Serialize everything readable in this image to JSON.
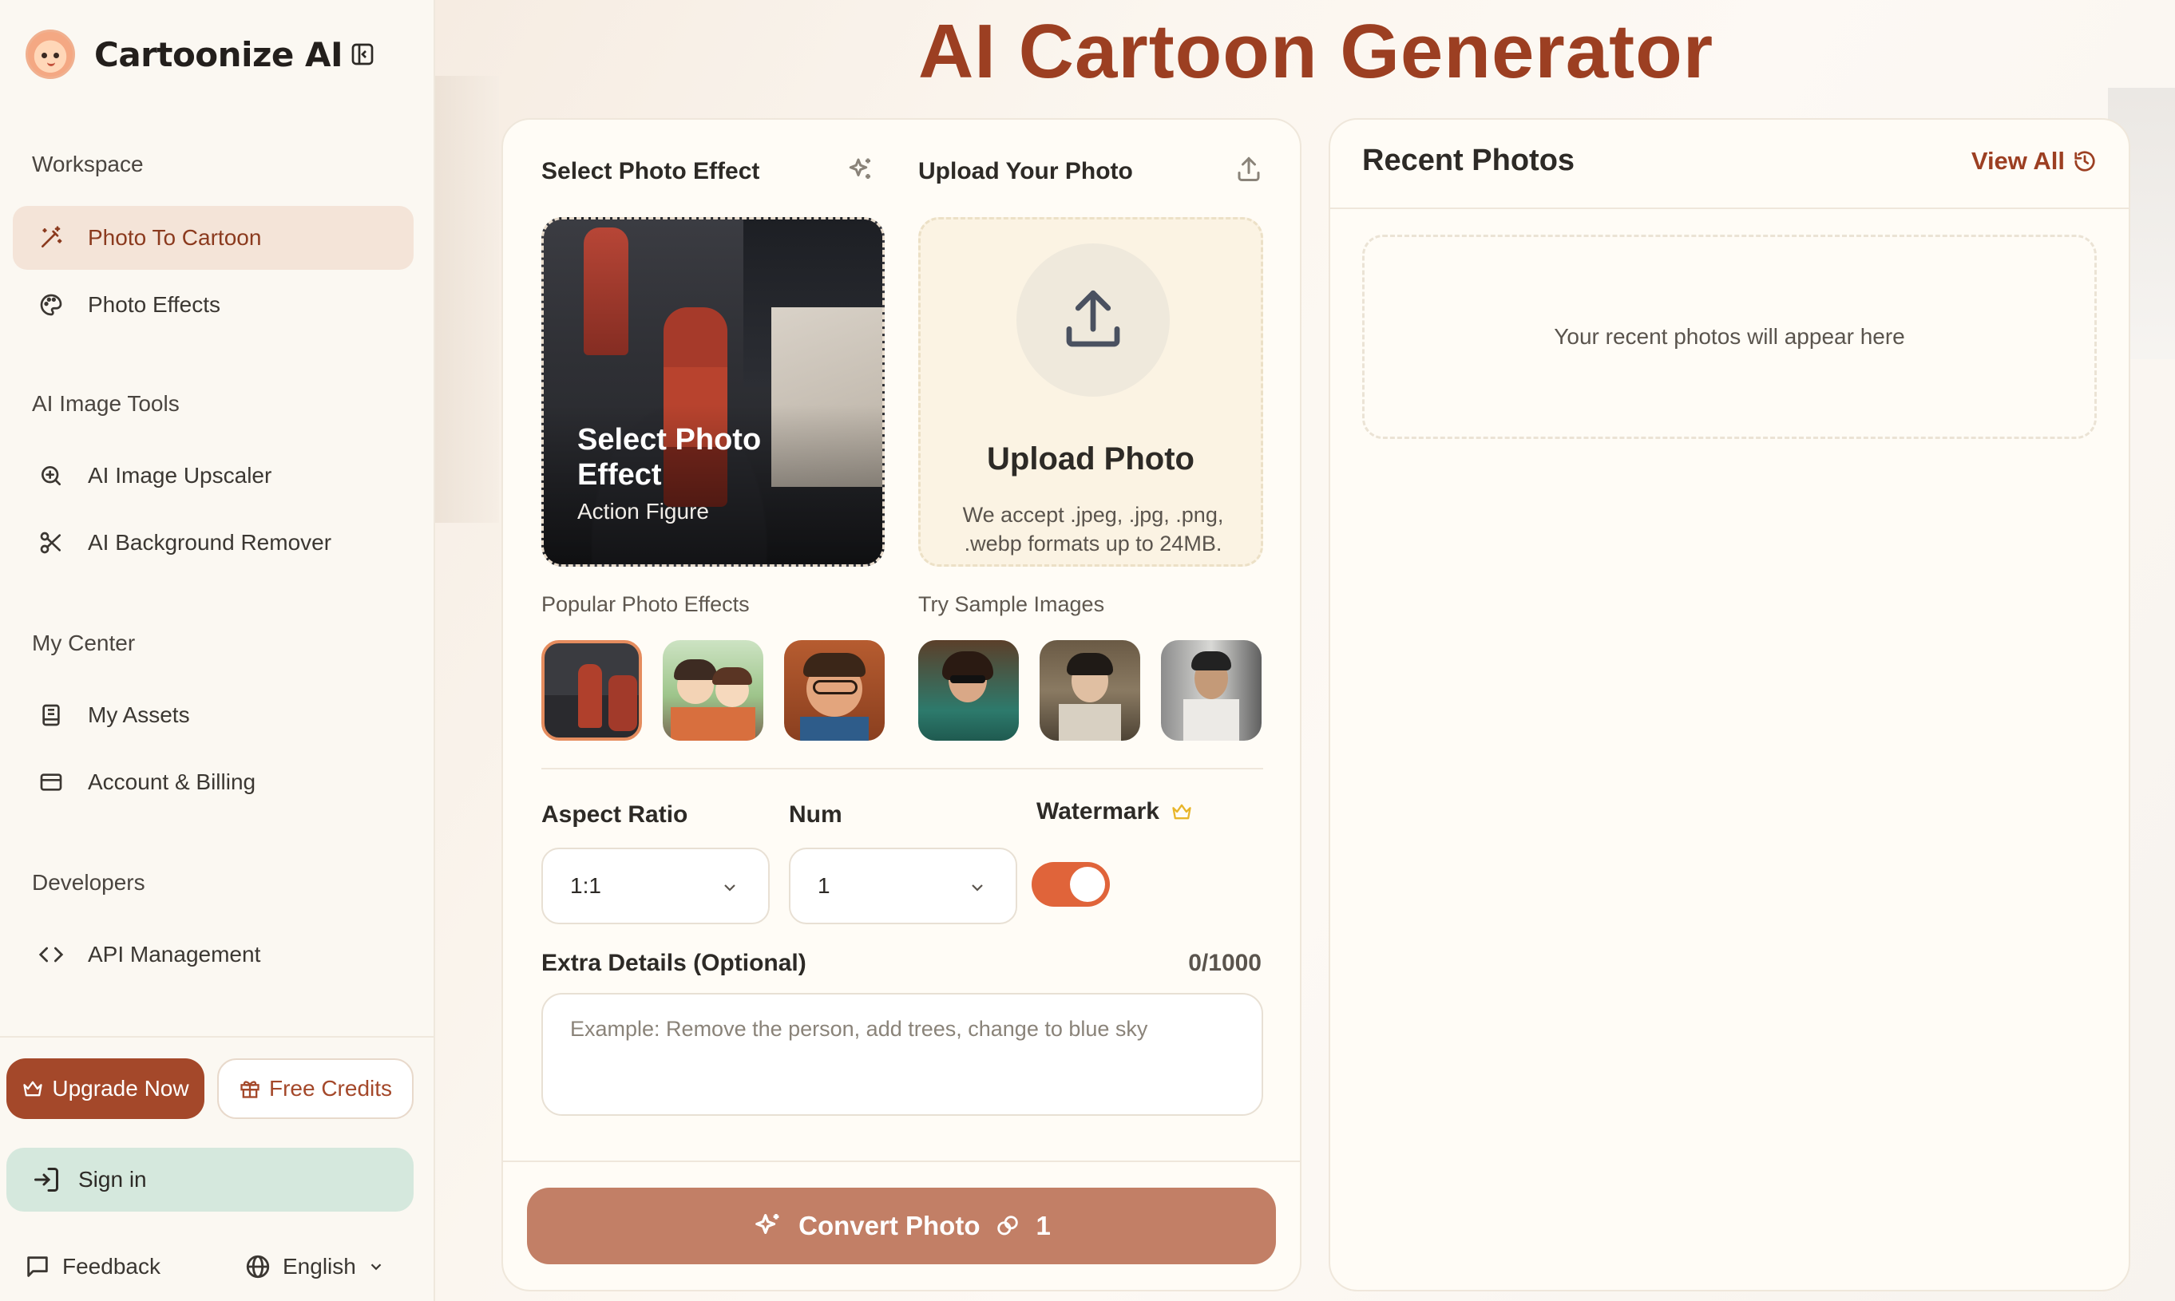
{
  "brand": {
    "name": "Cartoonize AI"
  },
  "sidebar": {
    "sections": [
      {
        "title": "Workspace",
        "items": [
          {
            "label": "Photo To Cartoon",
            "icon": "magic-wand-icon",
            "active": true
          },
          {
            "label": "Photo Effects",
            "icon": "palette-icon",
            "active": false
          }
        ]
      },
      {
        "title": "AI Image Tools",
        "items": [
          {
            "label": "AI Image Upscaler",
            "icon": "zoom-in-icon",
            "active": false
          },
          {
            "label": "AI Background Remover",
            "icon": "scissors-icon",
            "active": false
          }
        ]
      },
      {
        "title": "My Center",
        "items": [
          {
            "label": "My Assets",
            "icon": "book-icon",
            "active": false
          },
          {
            "label": "Account & Billing",
            "icon": "credit-card-icon",
            "active": false
          }
        ]
      },
      {
        "title": "Developers",
        "items": [
          {
            "label": "API Management",
            "icon": "code-icon",
            "active": false
          }
        ]
      }
    ],
    "upgrade_label": "Upgrade Now",
    "free_credits_label": "Free Credits",
    "signin_label": "Sign in",
    "feedback_label": "Feedback",
    "language_label": "English"
  },
  "main": {
    "title": "AI Cartoon Generator",
    "select_effect_heading": "Select Photo Effect",
    "upload_heading": "Upload Your Photo",
    "effect_card": {
      "title": "Select Photo Effect",
      "subtitle": "Action Figure"
    },
    "upload_card": {
      "title": "Upload Photo",
      "subtitle": "We accept .jpeg, .jpg, .png, .webp formats up to 24MB."
    },
    "popular_effects_label": "Popular Photo Effects",
    "sample_images_label": "Try Sample Images",
    "aspect_ratio": {
      "label": "Aspect Ratio",
      "value": "1:1"
    },
    "num": {
      "label": "Num",
      "value": "1"
    },
    "watermark": {
      "label": "Watermark",
      "enabled": true
    },
    "extra_details": {
      "label": "Extra Details (Optional)",
      "counter": "0/1000",
      "placeholder": "Example: Remove the person, add trees, change to blue sky"
    },
    "convert": {
      "label": "Convert Photo",
      "cost": "1"
    }
  },
  "recent": {
    "title": "Recent Photos",
    "view_all_label": "View All",
    "empty_text": "Your recent photos will appear here"
  },
  "colors": {
    "brand": "#9c3f22",
    "accent": "#e0643a",
    "convert": "#c27f66",
    "signin": "#d5e8dd"
  }
}
